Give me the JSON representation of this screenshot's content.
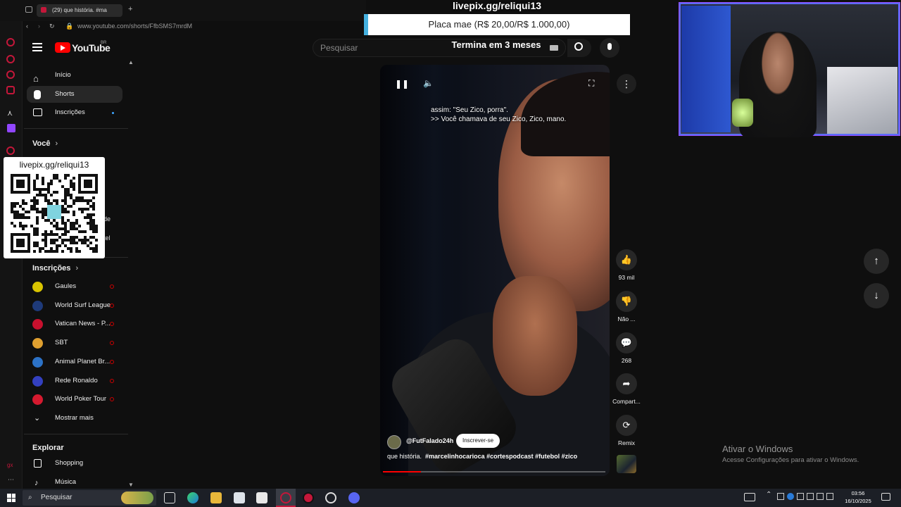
{
  "browser": {
    "tab_title": "(29) que história. #ma",
    "url": "www.youtube.com/shorts/FfbSMS7mrdM"
  },
  "youtube": {
    "logo_text": "YouTube",
    "country": "BR",
    "search_placeholder": "Pesquisar"
  },
  "sidebar": {
    "items": [
      {
        "label": "Início",
        "icon": "home-icon"
      },
      {
        "label": "Shorts",
        "icon": "shorts-icon"
      },
      {
        "label": "Inscrições",
        "icon": "subscriptions-icon"
      }
    ],
    "you_label": "Você",
    "subs_label": "Inscrições",
    "subscriptions": [
      {
        "name": "Gaules",
        "color": "#d9c400"
      },
      {
        "name": "World Surf League",
        "color": "#1e3a7a"
      },
      {
        "name": "Vatican News - P...",
        "color": "#c8102e"
      },
      {
        "name": "SBT",
        "color": "#e0a030"
      },
      {
        "name": "Animal Planet Br...",
        "color": "#2c72c7"
      },
      {
        "name": "Rede Ronaldo",
        "color": "#3340c0"
      },
      {
        "name": "World Poker Tour",
        "color": "#d51a2f"
      }
    ],
    "show_more": "Mostrar mais",
    "explore_label": "Explorar",
    "explore_items": [
      {
        "label": "Shopping",
        "icon": "shopping-icon"
      },
      {
        "label": "Música",
        "icon": "music-icon"
      }
    ],
    "hidden_fragments": [
      "de",
      "tel"
    ]
  },
  "short": {
    "caption_line1": "assim: \"Seu Zico, porra\".",
    "caption_line2": ">> Você chamava de seu Zico, Zico, mano.",
    "channel": "@FutFalado24h",
    "subscribe_label": "Inscrever-se",
    "title_plain": "que história.",
    "hashtags": "#marcelinhocarioca #cortespodcast #futebol #zico",
    "progress": 0.17
  },
  "actions": [
    {
      "label": "93 mil",
      "icon": "like-icon",
      "glyph": "👍"
    },
    {
      "label": "Não ...",
      "icon": "dislike-icon",
      "glyph": "👎"
    },
    {
      "label": "268",
      "icon": "comment-icon",
      "glyph": "💬"
    },
    {
      "label": "Compart...",
      "icon": "share-icon",
      "glyph": "➦"
    },
    {
      "label": "Remix",
      "icon": "remix-icon",
      "glyph": "⟳"
    }
  ],
  "overlay": {
    "livepix_url": "livepix.gg/reliqui13",
    "goal_text": "Placa mae (R$ 20,00/R$ 1.000,00)",
    "goal_time": "Termina em 3 meses",
    "qr_label": "livepix.gg/reliqui13"
  },
  "windows": {
    "activate_title": "Ativar o Windows",
    "activate_sub": "Acesse Configurações para ativar o Windows.",
    "taskbar_search": "Pesquisar",
    "time": "03:56",
    "date": "16/10/2025"
  }
}
